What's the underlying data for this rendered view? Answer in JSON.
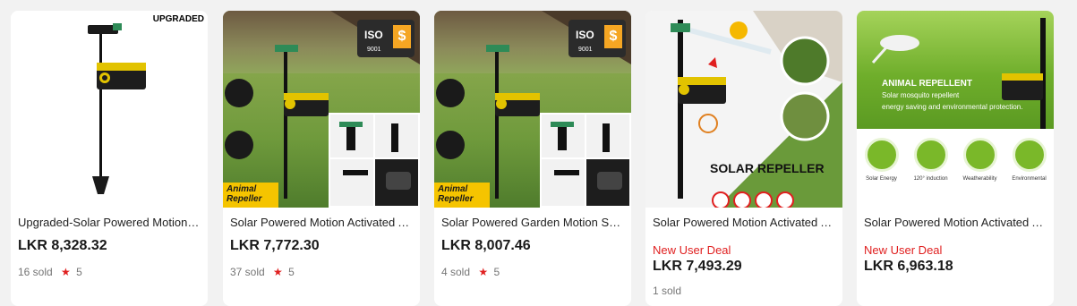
{
  "products": [
    {
      "title": "Upgraded-Solar Powered Motion Activated Animal Repeller Sprinkler",
      "price": "LKR 8,328.32",
      "deal": "",
      "sold": "16 sold",
      "rating": "5",
      "badge": "UPGRADED"
    },
    {
      "title": "Solar Powered Motion Activated Animal Repeller Sprinkler",
      "price": "LKR 7,772.30",
      "deal": "",
      "sold": "37 sold",
      "rating": "5",
      "logo_text": "ISO",
      "logo_sub": "9001",
      "corner_label_1": "Animal",
      "corner_label_2": "Repeller"
    },
    {
      "title": "Solar Powered Garden Motion Sprinkler Animal Repeller",
      "price": "LKR 8,007.46",
      "deal": "",
      "sold": "4 sold",
      "rating": "5",
      "logo_text": "ISO",
      "logo_sub": "9001",
      "corner_label_1": "Animal",
      "corner_label_2": "Repeller"
    },
    {
      "title": "Solar Powered Motion Activated Animal Repeller Sprinkler",
      "price": "LKR 7,493.29",
      "deal": "New User Deal",
      "sold": "1 sold",
      "rating": "",
      "banner": "SOLAR REPELLER"
    },
    {
      "title": "Solar Powered Motion Activated Animal Repeller",
      "price": "LKR 6,963.18",
      "deal": "New User Deal",
      "sold": "",
      "rating": "",
      "banner_title": "ANIMAL REPELLENT",
      "banner_line1": "Solar mosquito repellent",
      "banner_line2": "energy saving and environmental protection.",
      "features": [
        "Solar Energy",
        "120° induction",
        "Weatherability",
        "Environmental"
      ]
    }
  ],
  "colors": {
    "accent_red": "#e02020",
    "device_yellow": "#e2c300",
    "banner_yellow": "#f5c400",
    "green_banner": "#7ab829"
  }
}
